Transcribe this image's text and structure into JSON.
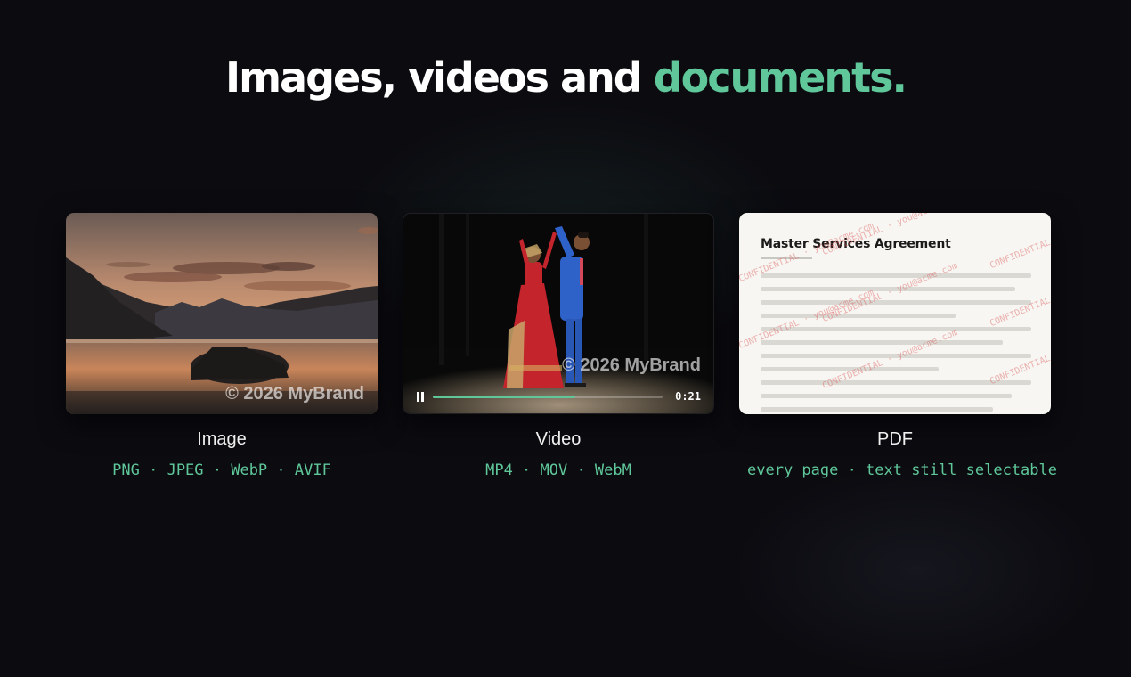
{
  "headline": {
    "part1": "Images, videos and ",
    "accent": "documents."
  },
  "colors": {
    "background": "#0b0b10",
    "accent": "#5fc79a",
    "text": "#f2f2f2"
  },
  "cards": {
    "image": {
      "label": "Image",
      "formats": "PNG · JPEG · WebP · AVIF",
      "watermark": "© 2026 MyBrand"
    },
    "video": {
      "label": "Video",
      "formats": "MP4 · MOV · WebM",
      "watermark": "© 2026 MyBrand",
      "time": "0:21",
      "progress": 0.62,
      "control_icon": "pause-icon"
    },
    "pdf": {
      "label": "PDF",
      "formats": "every page · text still selectable",
      "doc_title": "Master Services Agreement",
      "watermark_text": "CONFIDENTIAL · you@acme.com"
    }
  }
}
